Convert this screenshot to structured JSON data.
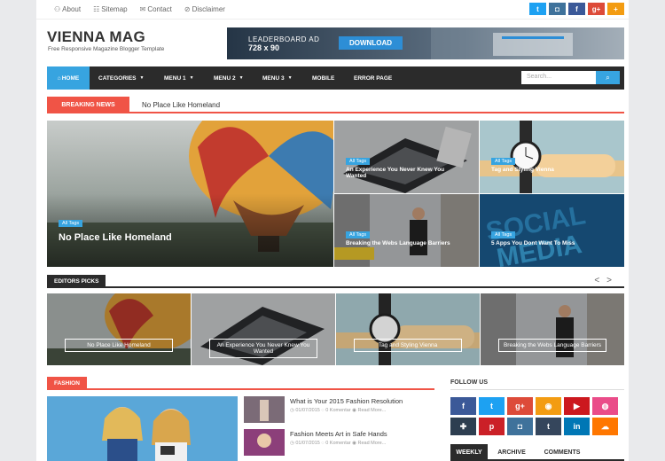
{
  "topbar": {
    "links": [
      {
        "icon": "user-icon",
        "glyph": "⚇",
        "label": "About"
      },
      {
        "icon": "sitemap-icon",
        "glyph": "☷",
        "label": "Sitemap"
      },
      {
        "icon": "envelope-icon",
        "glyph": "✉",
        "label": "Contact"
      },
      {
        "icon": "info-icon",
        "glyph": "⊘",
        "label": "Disclaimer"
      }
    ],
    "social": [
      {
        "name": "twitter-icon",
        "glyph": "t",
        "color": "#1da1f2"
      },
      {
        "name": "instagram-icon",
        "glyph": "◘",
        "color": "#3f729b"
      },
      {
        "name": "facebook-icon",
        "glyph": "f",
        "color": "#3b5998"
      },
      {
        "name": "google-plus-icon",
        "glyph": "g+",
        "color": "#dd4b39"
      },
      {
        "name": "plus-icon",
        "glyph": "+",
        "color": "#f39c12"
      }
    ]
  },
  "header": {
    "logo": "VIENNA MAG",
    "tagline": "Free Responsive Magazine Blogger Template",
    "ad": {
      "label": "LEADERBOARD AD",
      "size": "728 x 90",
      "button": "DOWNLOAD"
    }
  },
  "nav": {
    "home": "HOME",
    "items": [
      "CATEGORIES",
      "MENU 1",
      "MENU 2",
      "MENU 3",
      "MOBILE",
      "ERROR PAGE"
    ],
    "search_placeholder": "Search...",
    "accent": "#37a4e0"
  },
  "breaking": {
    "label": "BREAKING NEWS",
    "headline": "No Place Like Homeland",
    "color": "#f05446"
  },
  "featured": [
    {
      "tag": "All Tags",
      "title": "No Place Like Homeland"
    },
    {
      "tag": "All Tags",
      "title": "An Experience You Never Knew You Wanted"
    },
    {
      "tag": "All Tags",
      "title": "Tag and Styling Vienna"
    },
    {
      "tag": "All Tags",
      "title": "Breaking the Webs Language Barriers"
    },
    {
      "tag": "All Tags",
      "title": "5 Apps You Dont Want To Miss"
    }
  ],
  "editors": {
    "label": "EDITORS PICKS",
    "prev": "<",
    "next": ">",
    "items": [
      "No Place Like Homeland",
      "An Experience You Never Knew You Wanted",
      "Tag and Styling Vienna",
      "Breaking the Webs Language Barriers"
    ]
  },
  "fashion": {
    "label": "FASHION",
    "posts": [
      {
        "title": "What is Your 2015 Fashion Resolution",
        "date": "01/07/2015",
        "comments": "0 Komentar",
        "more": "Read More..."
      },
      {
        "title": "Fashion Meets Art in Safe Hands",
        "date": "01/07/2015",
        "comments": "0 Komentar",
        "more": "Read More..."
      }
    ]
  },
  "follow": {
    "label": "FOLLOW US",
    "icons": [
      {
        "name": "facebook-icon",
        "glyph": "f",
        "color": "#3b5998"
      },
      {
        "name": "twitter-icon",
        "glyph": "t",
        "color": "#1da1f2"
      },
      {
        "name": "google-plus-icon",
        "glyph": "g+",
        "color": "#dd4b39"
      },
      {
        "name": "rss-icon",
        "glyph": "◉",
        "color": "#f39c12"
      },
      {
        "name": "youtube-icon",
        "glyph": "▶",
        "color": "#cc181e"
      },
      {
        "name": "dribbble-icon",
        "glyph": "◍",
        "color": "#ea4c89"
      },
      {
        "name": "delicious-icon",
        "glyph": "✚",
        "color": "#2d3e50"
      },
      {
        "name": "pinterest-icon",
        "glyph": "p",
        "color": "#cb2027"
      },
      {
        "name": "instagram-icon",
        "glyph": "◘",
        "color": "#3f729b"
      },
      {
        "name": "tumblr-icon",
        "glyph": "t",
        "color": "#35465c"
      },
      {
        "name": "linkedin-icon",
        "glyph": "in",
        "color": "#0077b5"
      },
      {
        "name": "soundcloud-icon",
        "glyph": "☁",
        "color": "#ff7700"
      }
    ]
  },
  "tabs": [
    "WEEKLY",
    "ARCHIVE",
    "COMMENTS"
  ]
}
